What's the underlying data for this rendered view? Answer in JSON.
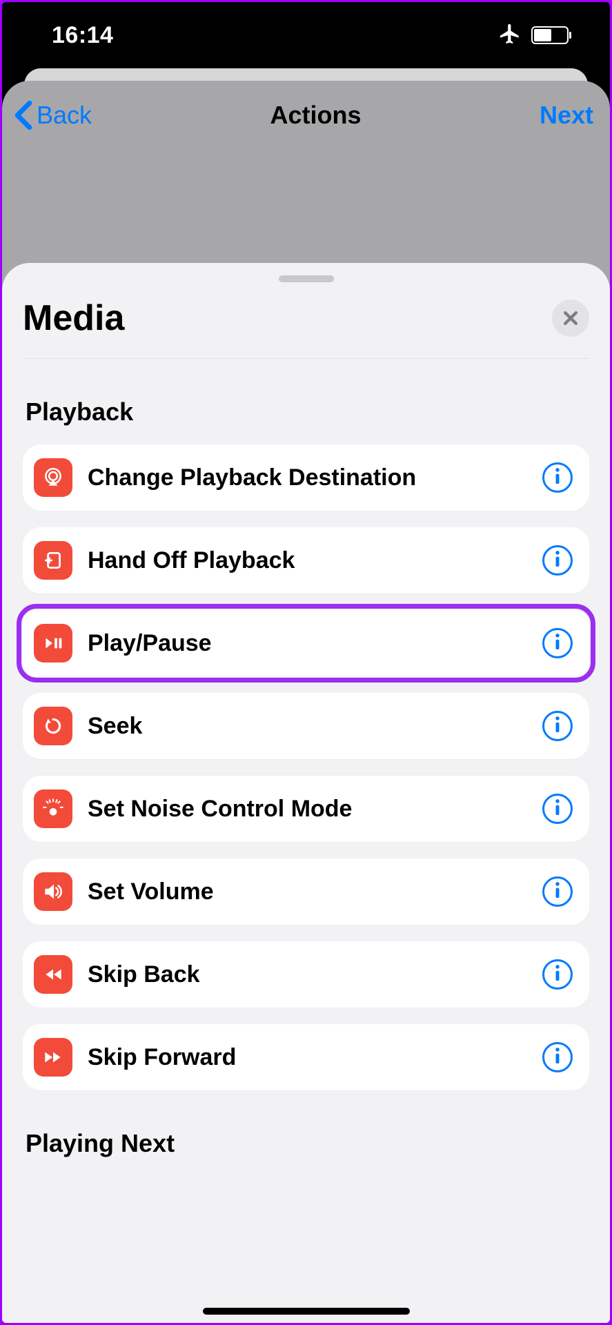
{
  "status": {
    "time": "16:14"
  },
  "nav": {
    "back": "Back",
    "title": "Actions",
    "next": "Next"
  },
  "sheet": {
    "title": "Media"
  },
  "sections": {
    "playback": {
      "title": "Playback",
      "items": [
        {
          "label": "Change Playback Destination",
          "icon": "airplay"
        },
        {
          "label": "Hand Off Playback",
          "icon": "handoff"
        },
        {
          "label": "Play/Pause",
          "icon": "playpause",
          "highlight": true
        },
        {
          "label": "Seek",
          "icon": "seek"
        },
        {
          "label": "Set Noise Control Mode",
          "icon": "noise"
        },
        {
          "label": "Set Volume",
          "icon": "volume"
        },
        {
          "label": "Skip Back",
          "icon": "skipback"
        },
        {
          "label": "Skip Forward",
          "icon": "skipforward"
        }
      ]
    },
    "playing_next": {
      "title": "Playing Next"
    }
  }
}
